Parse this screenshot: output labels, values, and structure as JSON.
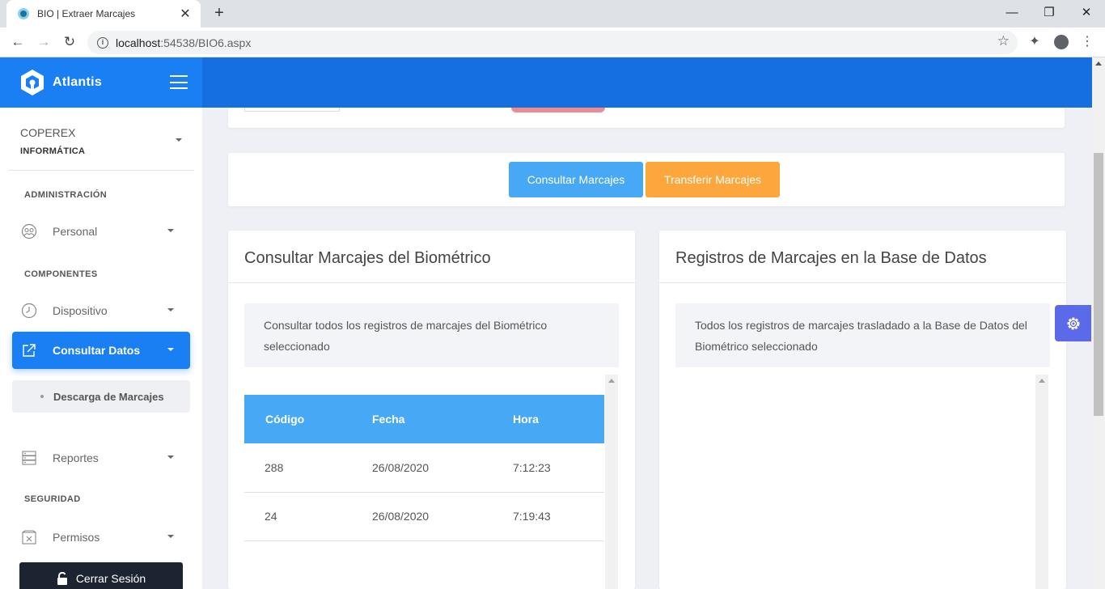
{
  "browser": {
    "tab_title": "BIO | Extraer Marcajes",
    "url_host": "localhost",
    "url_rest": ":54538/BIO6.aspx"
  },
  "app": {
    "brand": "Atlantis"
  },
  "sidebar": {
    "user_name": "COPEREX",
    "user_org": "INFORMÁTICA",
    "sections": {
      "admin": "ADMINISTRACIÓN",
      "components": "COMPONENTES",
      "security": "SEGURIDAD"
    },
    "items": {
      "personal": "Personal",
      "dispositivo": "Dispositivo",
      "consultar_datos": "Consultar Datos",
      "descarga_marcajes": "Descarga de Marcajes",
      "reportes": "Reportes",
      "permisos": "Permisos"
    },
    "logout": "Cerrar Sesión"
  },
  "actions": {
    "consult": "Consultar Marcajes",
    "transfer": "Transferir Marcajes"
  },
  "left_panel": {
    "title": "Consultar Marcajes del Biométrico",
    "description": "Consultar todos los registros de marcajes del Biométrico seleccionado",
    "table": {
      "headers": [
        "Código",
        "Fecha",
        "Hora"
      ],
      "rows": [
        [
          "288",
          "26/08/2020",
          "7:12:23"
        ],
        [
          "24",
          "26/08/2020",
          "7:19:43"
        ]
      ]
    }
  },
  "right_panel": {
    "title": "Registros de Marcajes en la Base de Datos",
    "description": "Todos los registros de marcajes trasladado a la Base de Datos del Biométrico seleccionado"
  },
  "colors": {
    "header": "#166fe0",
    "brand_bg": "#1a7ff2",
    "primary_button": "#47a9f5",
    "warning_button": "#fca63b",
    "sidebar_active": "#1a7ff2",
    "settings_tab": "#5b6ae8"
  }
}
